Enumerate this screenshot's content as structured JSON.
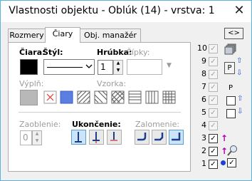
{
  "window": {
    "title": "Vlastnosti objektu - Oblúk (14) - vrstva: 1",
    "close_glyph": "✕"
  },
  "tabs": [
    {
      "label": "Rozmery"
    },
    {
      "label": "Čiary"
    },
    {
      "label": "Obj. manažér"
    }
  ],
  "top_right_button": "<>",
  "panel": {
    "ciara_label": "Čiara:",
    "styl_label": "Štýl:",
    "hrubka_label": "Hrúbka:",
    "hrubka_value": "1",
    "sipky_label": "Šípky:",
    "vypln_label": "Výplň:",
    "vzorka_label": "Vzorka:",
    "zaoblenie_label": "Zaoblenie:",
    "zaoblenie_value": "0",
    "ukoncenie_label": "Ukončenie:",
    "zalomenie_label": "Zalomenie:",
    "line_color": "#000000"
  },
  "layers": [
    {
      "num": "10",
      "checked": true
    },
    {
      "num": "9",
      "checked": true
    },
    {
      "num": "8",
      "checked": true
    },
    {
      "num": "7",
      "checked": true
    },
    {
      "num": "6",
      "checked": true
    },
    {
      "num": "5",
      "checked": true
    },
    {
      "num": "4",
      "checked": true
    },
    {
      "num": "3",
      "checked": true
    },
    {
      "num": "2",
      "checked": true
    },
    {
      "num": "1",
      "checked": true
    }
  ],
  "side_controls": {
    "p_button": "P",
    "p_label": "P"
  },
  "colors": {
    "accent": "#0078d7",
    "arrow_blue": "#2a52c9",
    "magenta": "#b000b0",
    "pattern_fill": "#5a7fe0"
  }
}
